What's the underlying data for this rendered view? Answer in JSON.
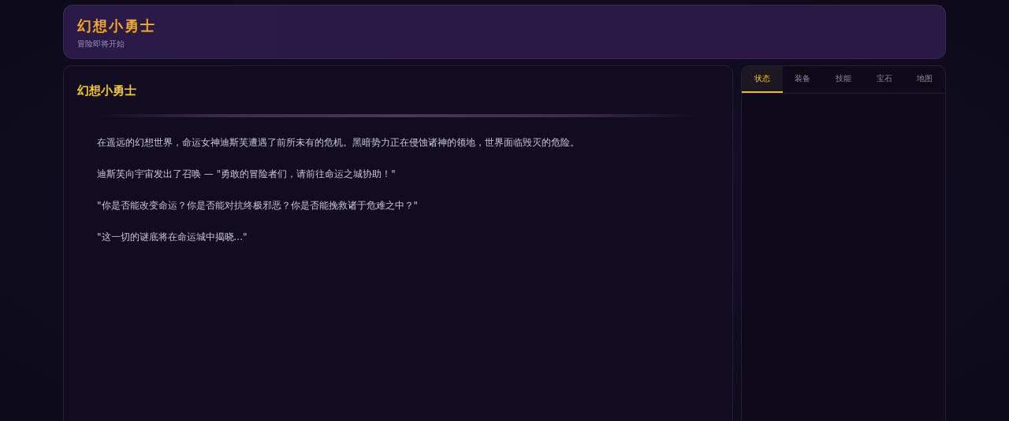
{
  "header": {
    "title": "幻想小勇士",
    "subtitle": "冒险即将开始"
  },
  "story": {
    "title": "幻想小勇士",
    "paragraphs": [
      "在遥远的幻想世界，命运女神迪斯芙遭遇了前所未有的危机。黑暗势力正在侵蚀诸神的领地，世界面临毁灭的危险。",
      "迪斯芙向宇宙发出了召唤 — \"勇敢的冒险者们，请前往命运之城协助！\"",
      "\"你是否能改变命运？你是否能对抗终极邪恶？你是否能挽救诸于危难之中？\"",
      "\"这一切的谜底将在命运城中揭晓...\""
    ]
  },
  "tabs": [
    {
      "label": "状态",
      "selected": true
    },
    {
      "label": "装备",
      "selected": false
    },
    {
      "label": "技能",
      "selected": false
    },
    {
      "label": "宝石",
      "selected": false
    },
    {
      "label": "地图",
      "selected": false
    }
  ]
}
